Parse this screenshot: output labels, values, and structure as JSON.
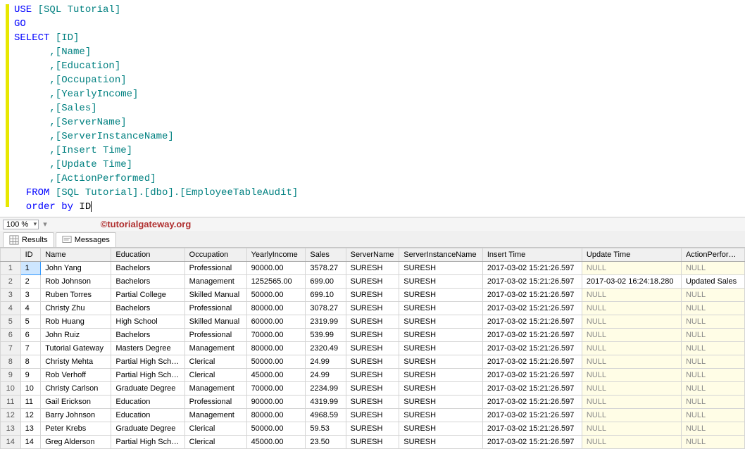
{
  "sql": {
    "l1a": "USE",
    "l1b": " [SQL Tutorial]",
    "l2": "GO",
    "l3a": "SELECT",
    "l3b": " [ID]",
    "l4": "      ,[Name]",
    "l5": "      ,[Education]",
    "l6": "      ,[Occupation]",
    "l7": "      ,[YearlyIncome]",
    "l8": "      ,[Sales]",
    "l9": "      ,[ServerName]",
    "l10": "      ,[ServerInstanceName]",
    "l11": "      ,[Insert Time]",
    "l12": "      ,[Update Time]",
    "l13": "      ,[ActionPerformed]",
    "l14a": "  FROM",
    "l14b": " [SQL Tutorial].[dbo].[EmployeeTableAudit]",
    "l14dot1": ".",
    "l14dot2": ".",
    "l15a": "  order",
    "l15b": " by",
    "l15c": " ID"
  },
  "zoom": {
    "value": "100 %"
  },
  "watermark": "©tutorialgateway.org",
  "tabs": {
    "results": "Results",
    "messages": "Messages"
  },
  "grid": {
    "headers": [
      "ID",
      "Name",
      "Education",
      "Occupation",
      "YearlyIncome",
      "Sales",
      "ServerName",
      "ServerInstanceName",
      "Insert Time",
      "Update Time",
      "ActionPerformed"
    ],
    "null_text": "NULL",
    "rows": [
      {
        "n": "1",
        "id": "1",
        "name": "John Yang",
        "edu": "Bachelors",
        "occ": "Professional",
        "inc": "90000.00",
        "sales": "3578.27",
        "srv": "SURESH",
        "inst": "SURESH",
        "ins": "2017-03-02 15:21:26.597",
        "upd": "NULL",
        "act": "NULL"
      },
      {
        "n": "2",
        "id": "2",
        "name": "Rob Johnson",
        "edu": "Bachelors",
        "occ": "Management",
        "inc": "1252565.00",
        "sales": "699.00",
        "srv": "SURESH",
        "inst": "SURESH",
        "ins": "2017-03-02 15:21:26.597",
        "upd": "2017-03-02 16:24:18.280",
        "act": "Updated Sales"
      },
      {
        "n": "3",
        "id": "3",
        "name": "Ruben Torres",
        "edu": "Partial College",
        "occ": "Skilled Manual",
        "inc": "50000.00",
        "sales": "699.10",
        "srv": "SURESH",
        "inst": "SURESH",
        "ins": "2017-03-02 15:21:26.597",
        "upd": "NULL",
        "act": "NULL"
      },
      {
        "n": "4",
        "id": "4",
        "name": "Christy Zhu",
        "edu": "Bachelors",
        "occ": "Professional",
        "inc": "80000.00",
        "sales": "3078.27",
        "srv": "SURESH",
        "inst": "SURESH",
        "ins": "2017-03-02 15:21:26.597",
        "upd": "NULL",
        "act": "NULL"
      },
      {
        "n": "5",
        "id": "5",
        "name": "Rob Huang",
        "edu": "High School",
        "occ": "Skilled Manual",
        "inc": "60000.00",
        "sales": "2319.99",
        "srv": "SURESH",
        "inst": "SURESH",
        "ins": "2017-03-02 15:21:26.597",
        "upd": "NULL",
        "act": "NULL"
      },
      {
        "n": "6",
        "id": "6",
        "name": "John Ruiz",
        "edu": "Bachelors",
        "occ": "Professional",
        "inc": "70000.00",
        "sales": "539.99",
        "srv": "SURESH",
        "inst": "SURESH",
        "ins": "2017-03-02 15:21:26.597",
        "upd": "NULL",
        "act": "NULL"
      },
      {
        "n": "7",
        "id": "7",
        "name": "Tutorial Gateway",
        "edu": "Masters Degree",
        "occ": "Management",
        "inc": "80000.00",
        "sales": "2320.49",
        "srv": "SURESH",
        "inst": "SURESH",
        "ins": "2017-03-02 15:21:26.597",
        "upd": "NULL",
        "act": "NULL"
      },
      {
        "n": "8",
        "id": "8",
        "name": "Christy Mehta",
        "edu": "Partial High School",
        "occ": "Clerical",
        "inc": "50000.00",
        "sales": "24.99",
        "srv": "SURESH",
        "inst": "SURESH",
        "ins": "2017-03-02 15:21:26.597",
        "upd": "NULL",
        "act": "NULL"
      },
      {
        "n": "9",
        "id": "9",
        "name": "Rob Verhoff",
        "edu": "Partial High School",
        "occ": "Clerical",
        "inc": "45000.00",
        "sales": "24.99",
        "srv": "SURESH",
        "inst": "SURESH",
        "ins": "2017-03-02 15:21:26.597",
        "upd": "NULL",
        "act": "NULL"
      },
      {
        "n": "10",
        "id": "10",
        "name": "Christy Carlson",
        "edu": "Graduate Degree",
        "occ": "Management",
        "inc": "70000.00",
        "sales": "2234.99",
        "srv": "SURESH",
        "inst": "SURESH",
        "ins": "2017-03-02 15:21:26.597",
        "upd": "NULL",
        "act": "NULL"
      },
      {
        "n": "11",
        "id": "11",
        "name": "Gail Erickson",
        "edu": "Education",
        "occ": "Professional",
        "inc": "90000.00",
        "sales": "4319.99",
        "srv": "SURESH",
        "inst": "SURESH",
        "ins": "2017-03-02 15:21:26.597",
        "upd": "NULL",
        "act": "NULL"
      },
      {
        "n": "12",
        "id": "12",
        "name": "Barry Johnson",
        "edu": "Education",
        "occ": "Management",
        "inc": "80000.00",
        "sales": "4968.59",
        "srv": "SURESH",
        "inst": "SURESH",
        "ins": "2017-03-02 15:21:26.597",
        "upd": "NULL",
        "act": "NULL"
      },
      {
        "n": "13",
        "id": "13",
        "name": "Peter Krebs",
        "edu": "Graduate Degree",
        "occ": "Clerical",
        "inc": "50000.00",
        "sales": "59.53",
        "srv": "SURESH",
        "inst": "SURESH",
        "ins": "2017-03-02 15:21:26.597",
        "upd": "NULL",
        "act": "NULL"
      },
      {
        "n": "14",
        "id": "14",
        "name": "Greg Alderson",
        "edu": "Partial High School",
        "occ": "Clerical",
        "inc": "45000.00",
        "sales": "23.50",
        "srv": "SURESH",
        "inst": "SURESH",
        "ins": "2017-03-02 15:21:26.597",
        "upd": "NULL",
        "act": "NULL"
      }
    ]
  }
}
